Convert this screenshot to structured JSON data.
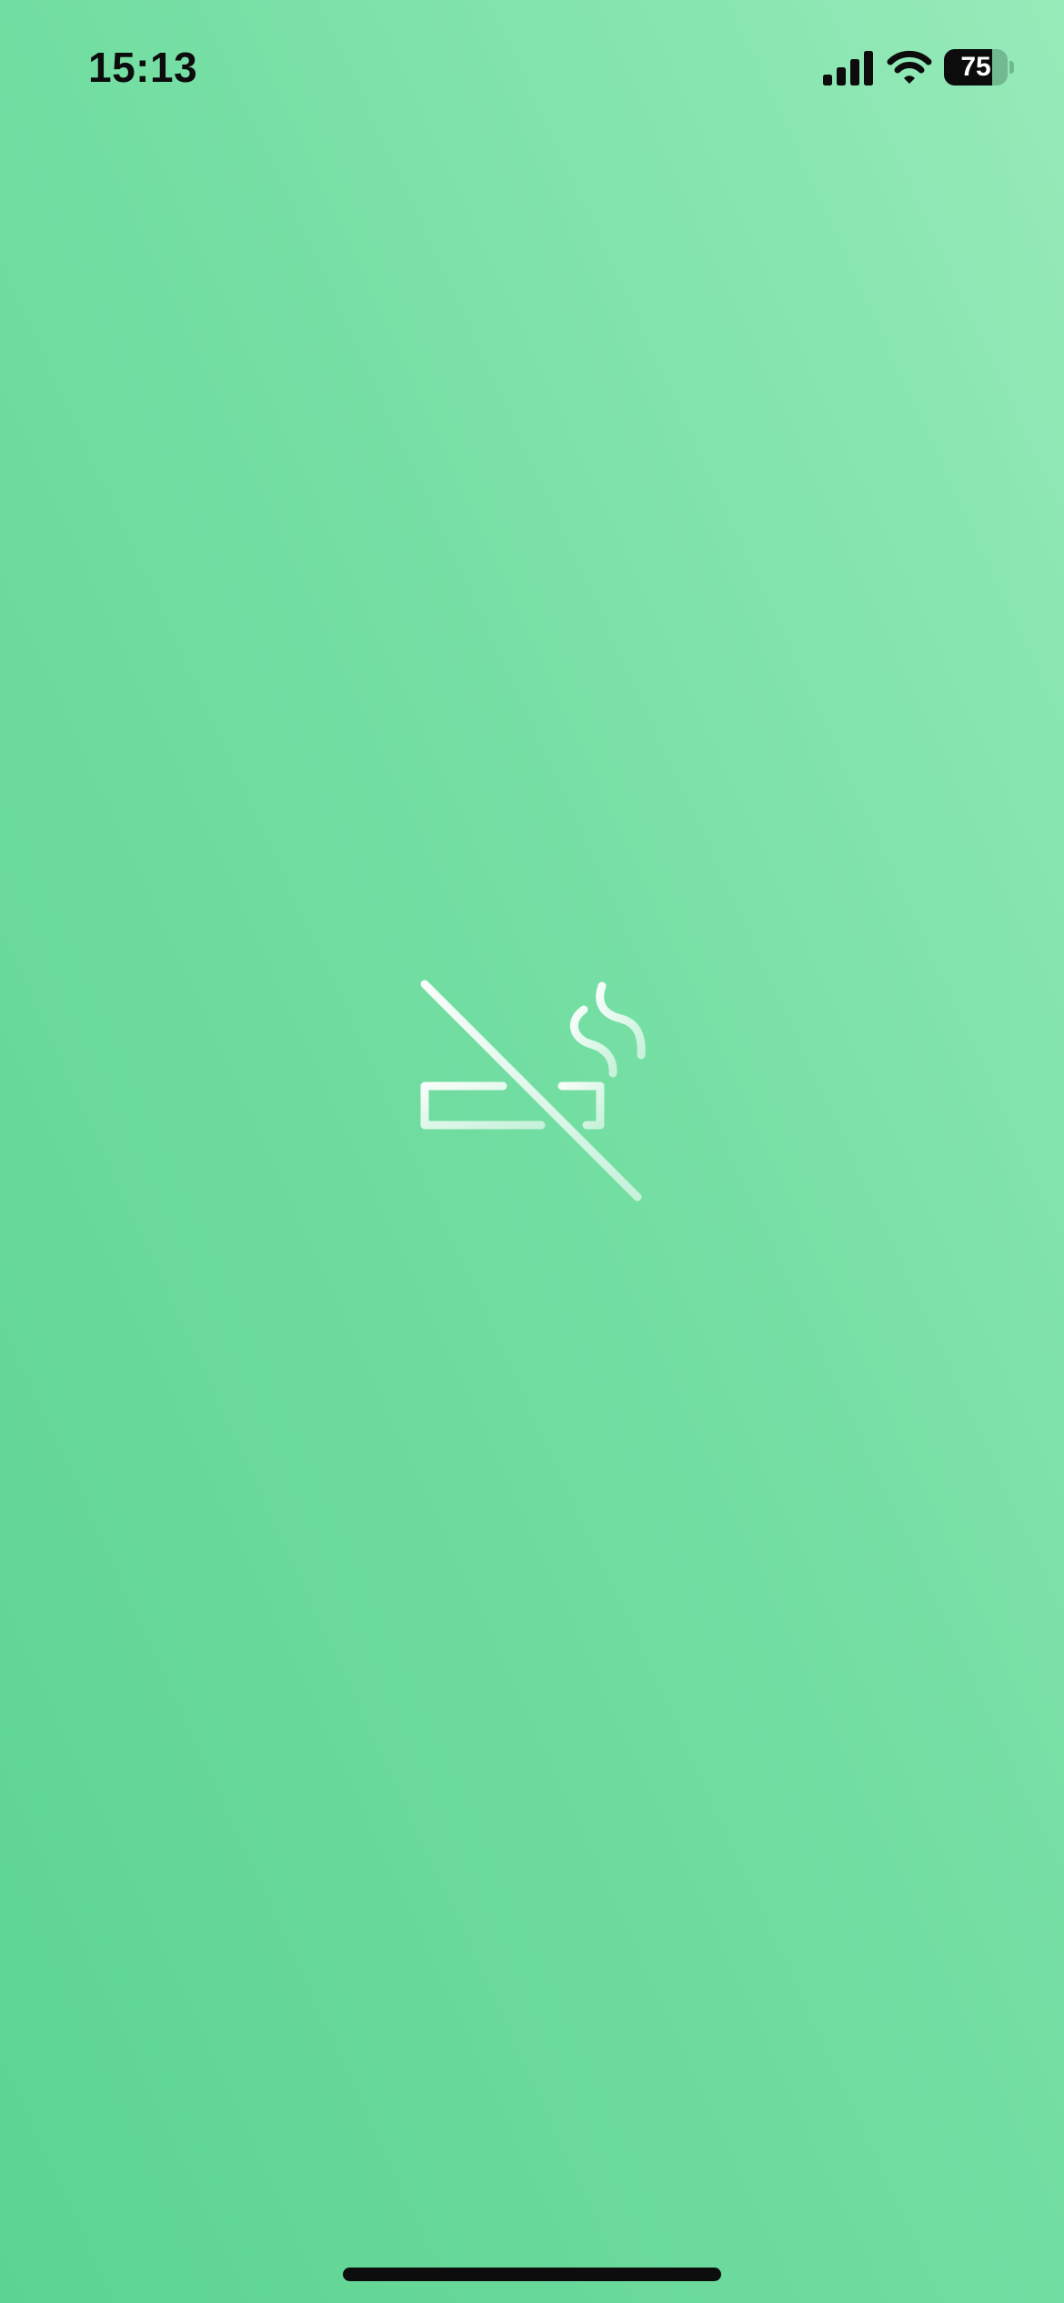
{
  "status_bar": {
    "time": "15:13",
    "battery_level": "75",
    "battery_fraction": 0.75
  },
  "icons": {
    "signal": "cellular-signal-icon",
    "wifi": "wifi-icon",
    "logo": "no-smoking-icon"
  },
  "colors": {
    "background_start": "#5dd391",
    "background_end": "#96eab9",
    "icon": "#ffffff",
    "status_text": "#0c0c0c",
    "home_indicator": "#0d0d0d"
  }
}
